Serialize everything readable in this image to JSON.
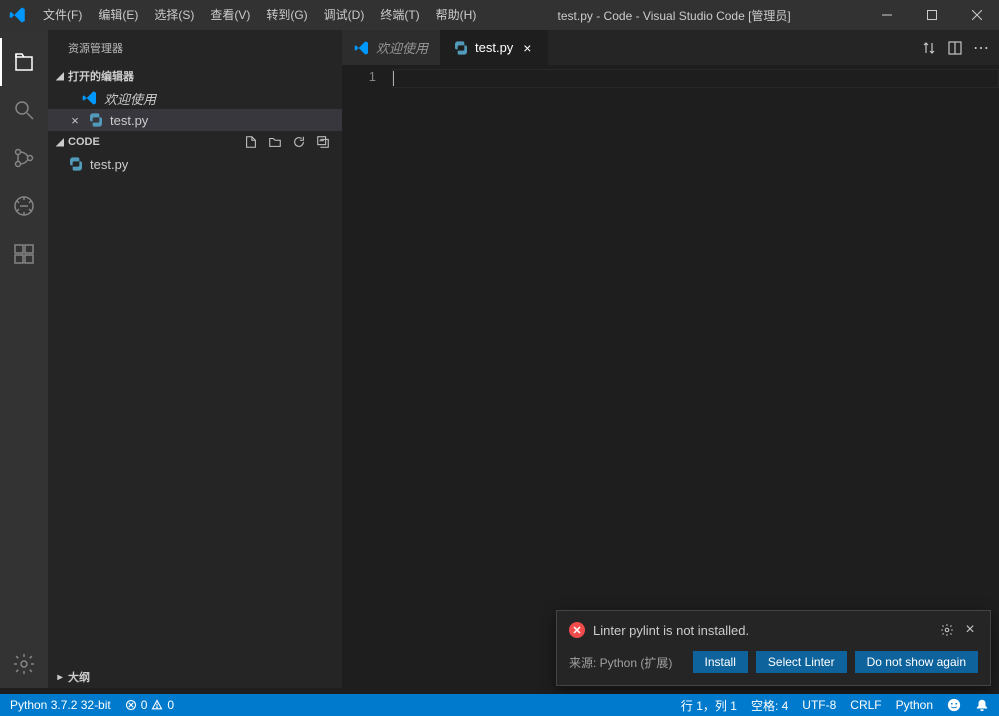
{
  "titlebar": {
    "title": "test.py - Code - Visual Studio Code [管理员]",
    "menus": [
      "文件(F)",
      "编辑(E)",
      "选择(S)",
      "查看(V)",
      "转到(G)",
      "调试(D)",
      "终端(T)",
      "帮助(H)"
    ]
  },
  "sidebar": {
    "title": "资源管理器",
    "open_editors_label": "打开的编辑器",
    "open_editors": [
      {
        "name": "欢迎使用",
        "icon": "vscode",
        "italic": true
      },
      {
        "name": "test.py",
        "icon": "python",
        "close": true,
        "active": true
      }
    ],
    "workspace_label": "CODE",
    "workspace_files": [
      {
        "name": "test.py",
        "icon": "python"
      }
    ],
    "outline_label": "大纲"
  },
  "tabs": [
    {
      "name": "欢迎使用",
      "icon": "vscode",
      "active": false
    },
    {
      "name": "test.py",
      "icon": "python",
      "active": true,
      "closable": true
    }
  ],
  "editor": {
    "line_numbers": [
      "1"
    ]
  },
  "notification": {
    "message": "Linter pylint is not installed.",
    "source": "来源: Python (扩展)",
    "buttons": {
      "install": "Install",
      "select": "Select Linter",
      "dismiss": "Do not show again"
    }
  },
  "statusbar": {
    "python": "Python 3.7.2 32-bit",
    "errors": "0",
    "warnings": "0",
    "line_col": "行 1，列 1",
    "spaces": "空格: 4",
    "encoding": "UTF-8",
    "eol": "CRLF",
    "lang": "Python"
  }
}
